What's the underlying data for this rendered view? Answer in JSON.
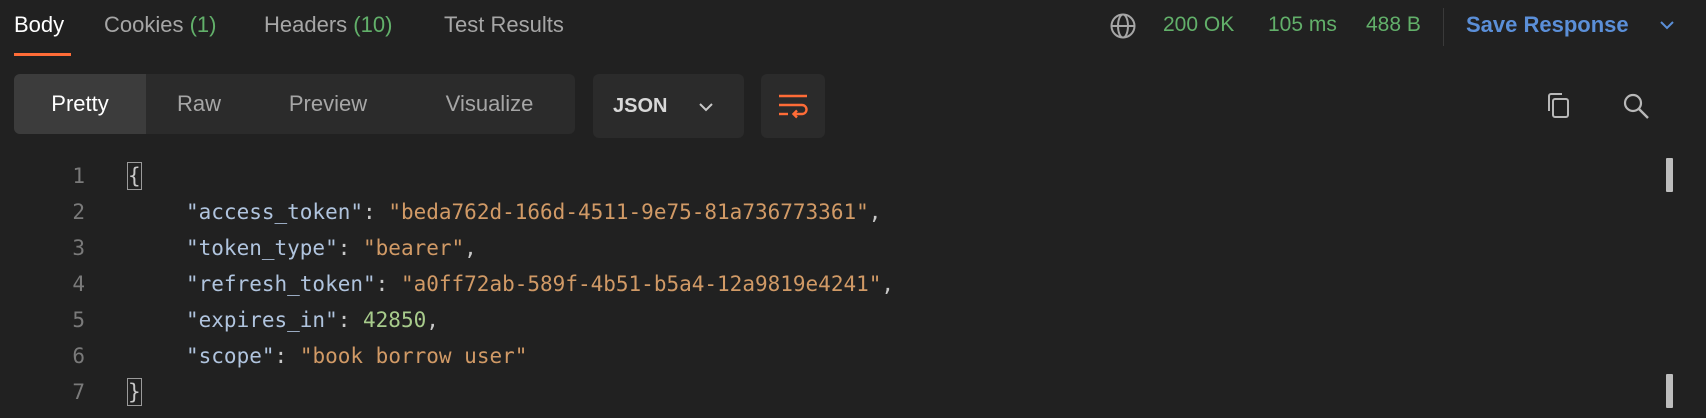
{
  "tabs": [
    {
      "label": "Body",
      "count": ""
    },
    {
      "label": "Cookies",
      "count": "(1)"
    },
    {
      "label": "Headers",
      "count": "(10)"
    },
    {
      "label": "Test Results",
      "count": ""
    }
  ],
  "status": {
    "code": "200 OK",
    "time": "105 ms",
    "size": "488 B",
    "save_label": "Save Response"
  },
  "view_modes": [
    "Pretty",
    "Raw",
    "Preview",
    "Visualize"
  ],
  "format": {
    "selected": "JSON"
  },
  "colors": {
    "accent": "#ff6c37",
    "status_green": "#62b06a",
    "link_blue": "#5b8fd8",
    "string": "#d19a66",
    "number": "#a8cc8c"
  },
  "icons": {
    "globe": "globe-icon",
    "chevron": "chevron-down-icon",
    "wrap": "word-wrap-icon",
    "copy": "copy-icon",
    "search": "search-icon"
  },
  "code": {
    "line_numbers": [
      "1",
      "2",
      "3",
      "4",
      "5",
      "6",
      "7"
    ],
    "open_brace": "{",
    "close_brace": "}",
    "entries": [
      {
        "key": "\"access_token\"",
        "value": "\"beda762d-166d-4511-9e75-81a736773361\"",
        "comma": ","
      },
      {
        "key": "\"token_type\"",
        "value": "\"bearer\"",
        "comma": ","
      },
      {
        "key": "\"refresh_token\"",
        "value": "\"a0ff72ab-589f-4b51-b5a4-12a9819e4241\"",
        "comma": ","
      },
      {
        "key": "\"expires_in\"",
        "value": "42850",
        "comma": ","
      },
      {
        "key": "\"scope\"",
        "value": "\"book borrow user\"",
        "comma": ""
      }
    ]
  }
}
